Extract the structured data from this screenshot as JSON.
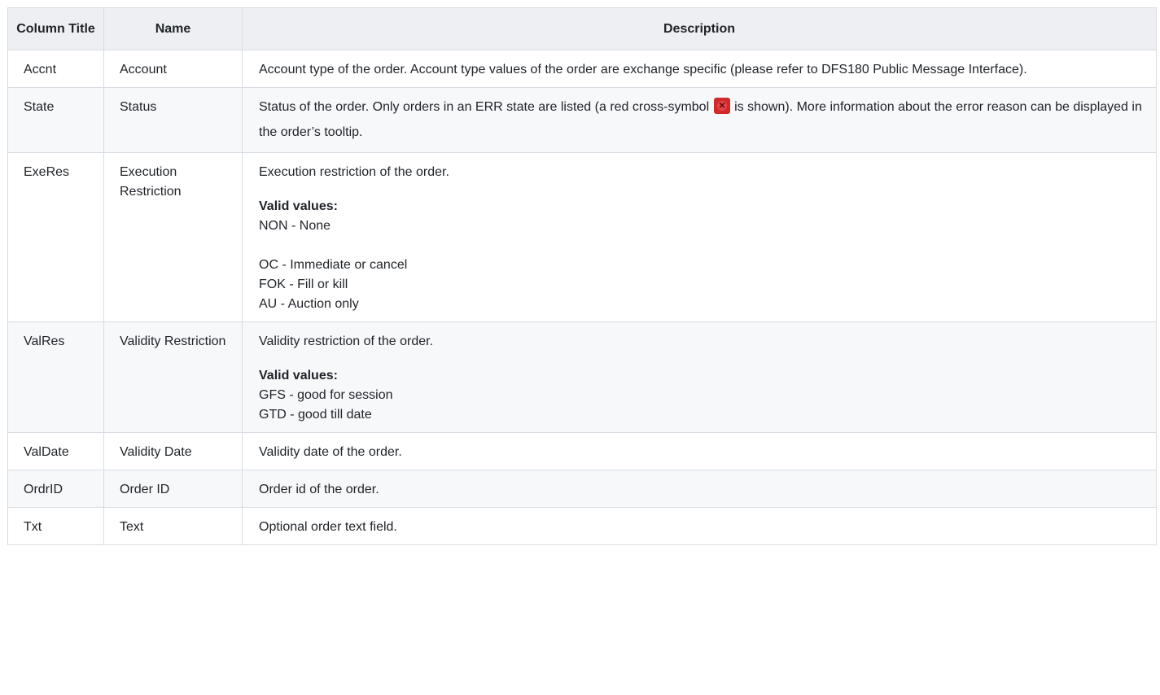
{
  "table": {
    "headers": {
      "column_title": "Column Title",
      "name": "Name",
      "description": "Description"
    },
    "rows": [
      {
        "column_title": "Accnt",
        "name": "Account",
        "description": "Account type of the order. Account type values of the order are exchange specific (please refer to DFS180 Public Message Interface)."
      },
      {
        "column_title": "State",
        "name": "Status",
        "description_before_icon": "Status of the order. Only orders in an ERR state are listed (a red cross-symbol",
        "icon": "red-cross-error-icon",
        "description_after_icon": "is shown). More information about the error reason can be displayed in the order’s tooltip."
      },
      {
        "column_title": "ExeRes",
        "name": "Execution Restriction",
        "description": "Execution restriction of the order.",
        "valid_label": "Valid values:",
        "values": [
          "NON - None",
          "OC - Immediate or cancel",
          "FOK - Fill or kill",
          "AU - Auction only"
        ]
      },
      {
        "column_title": "ValRes",
        "name": "Validity Restriction",
        "description": "Validity restriction of the order.",
        "valid_label": "Valid values:",
        "values": [
          "GFS - good for session",
          "GTD - good till date"
        ]
      },
      {
        "column_title": "ValDate",
        "name": "Validity Date",
        "description": "Validity date of the order."
      },
      {
        "column_title": "OrdrID",
        "name": "Order ID",
        "description": "Order id of the order."
      },
      {
        "column_title": "Txt",
        "name": "Text",
        "description": "Optional order text field."
      }
    ]
  }
}
